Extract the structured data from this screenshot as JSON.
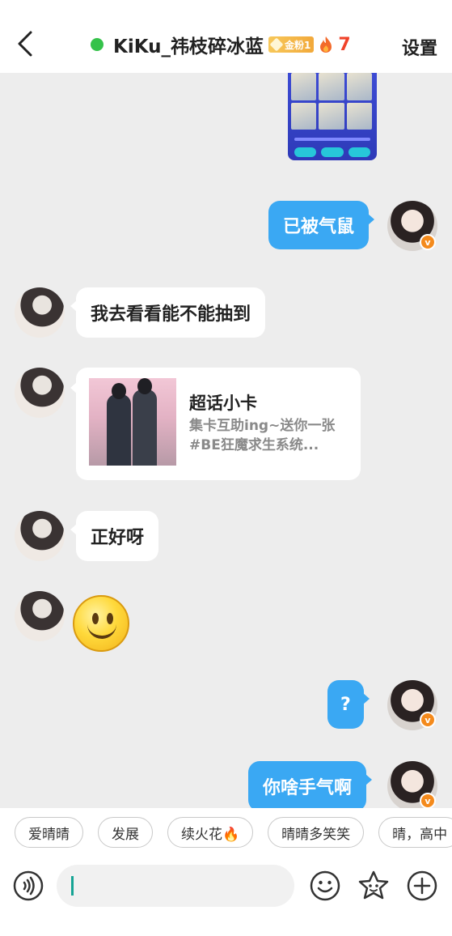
{
  "header": {
    "title": "KiKu_祎枝碎冰蓝",
    "fan_badge": "金粉1",
    "streak_count": "7",
    "settings_label": "设置",
    "online_color": "#35c24a"
  },
  "messages": [
    {
      "id": "m1",
      "side": "me",
      "type": "image"
    },
    {
      "id": "m2",
      "side": "me",
      "type": "text",
      "text": "已被气鼠"
    },
    {
      "id": "m3",
      "side": "them",
      "type": "text",
      "text": "我去看看能不能抽到"
    },
    {
      "id": "m4",
      "side": "them",
      "type": "card",
      "title": "超话小卡",
      "desc": "集卡互助ing~送你一张#BE狂魔求生系统..."
    },
    {
      "id": "m5",
      "side": "them",
      "type": "text",
      "text": "正好呀"
    },
    {
      "id": "m6",
      "side": "them",
      "type": "emoji",
      "emoji": "smile"
    },
    {
      "id": "m7",
      "side": "me",
      "type": "text",
      "text": "?"
    },
    {
      "id": "m8",
      "side": "me",
      "type": "text",
      "text": "你啥手气啊"
    }
  ],
  "verified_badge": "v",
  "quick_replies": [
    "爱晴晴",
    "发展",
    "续火花🔥",
    "晴晴多笑笑",
    "晴，高中"
  ],
  "input": {
    "value": "",
    "icons": [
      "voice-icon",
      "emoji-icon",
      "sticker-icon",
      "plus-icon"
    ]
  },
  "colors": {
    "my_bubble": "#3aa8f3",
    "their_bubble": "#ffffff",
    "background": "#ededed",
    "caret": "#16a495"
  }
}
